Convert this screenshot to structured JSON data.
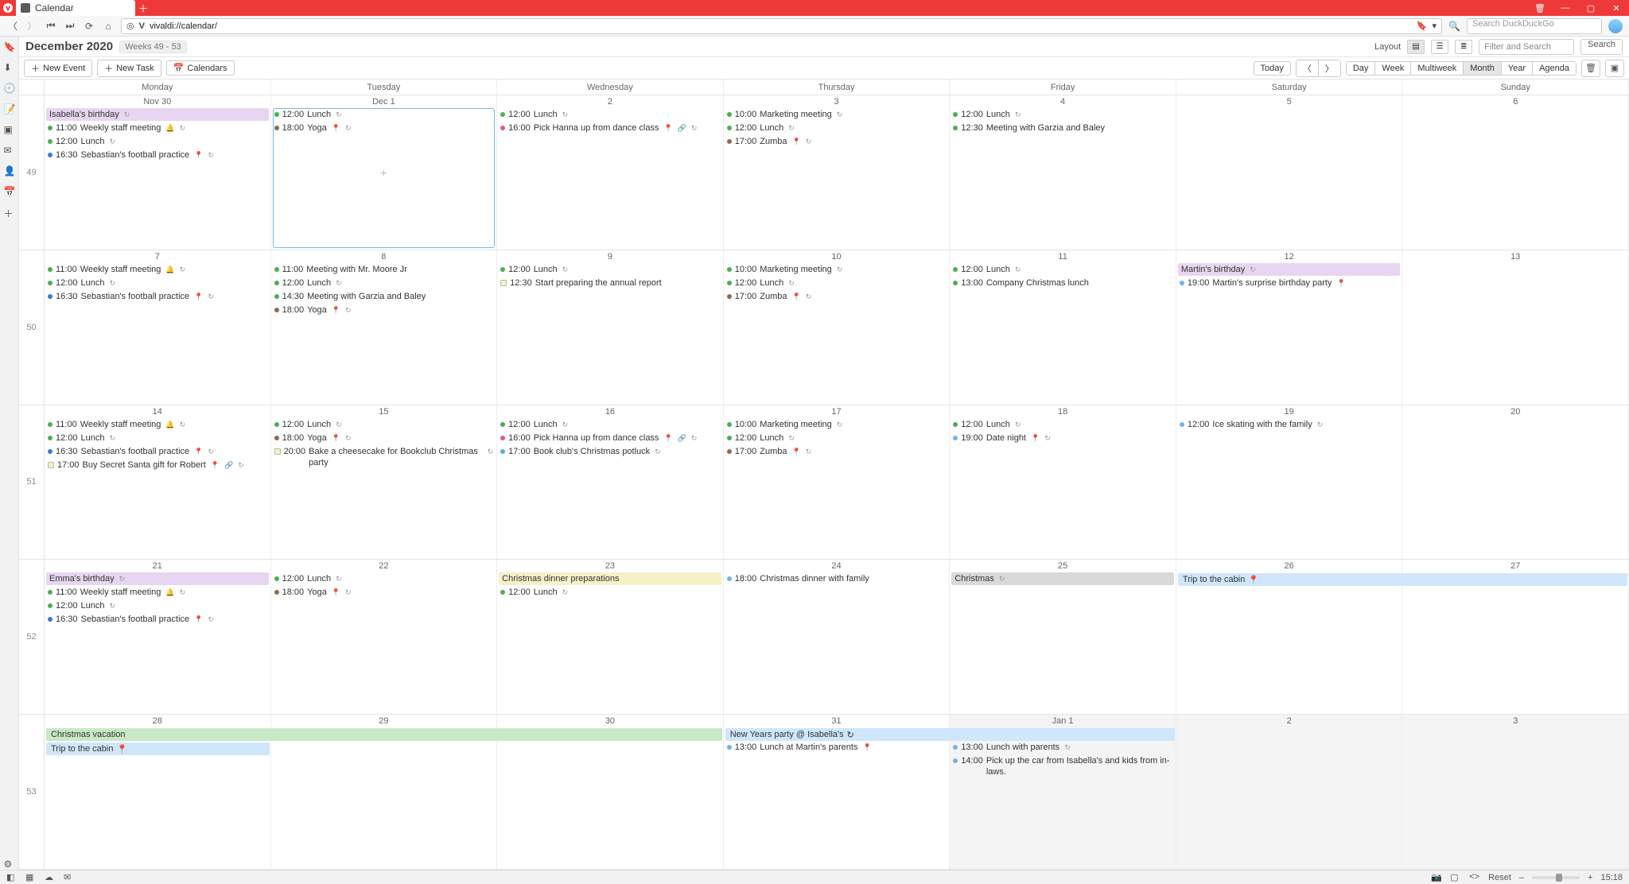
{
  "window": {
    "title": "Calendar"
  },
  "address": {
    "url_display": "vivaldi://calendar/",
    "search_placeholder": "Search DuckDuckGo"
  },
  "header": {
    "month_label": "December 2020",
    "weeks_label": "Weeks 49 - 53",
    "layout_label": "Layout",
    "filter_placeholder": "Filter and Search",
    "search_btn": "Search"
  },
  "toolbar": {
    "new_event": "New Event",
    "new_task": "New Task",
    "calendars": "Calendars",
    "today": "Today",
    "views": [
      "Day",
      "Week",
      "Multiweek",
      "Month",
      "Year",
      "Agenda"
    ],
    "view_selected": 3
  },
  "status": {
    "reset": "Reset",
    "clock": "15:18"
  },
  "days": [
    "Monday",
    "Tuesday",
    "Wednesday",
    "Thursday",
    "Friday",
    "Saturday",
    "Sunday"
  ],
  "week_numbers": [
    49,
    50,
    51,
    52,
    53
  ],
  "grid": [
    [
      {
        "d": "Nov 30",
        "events": [
          {
            "type": "allday",
            "color": "#e8d5f2",
            "text": "Isabella's birthday",
            "ics": [
              "↻"
            ]
          },
          {
            "dot": "c-green",
            "time": "11:00",
            "text": "Weekly staff meeting",
            "ics": [
              "🔔",
              "↻"
            ]
          },
          {
            "dot": "c-green",
            "time": "12:00",
            "text": "Lunch",
            "ics": [
              "↻"
            ]
          },
          {
            "dot": "c-blue",
            "time": "16:30",
            "text": "Sebastian's football practice",
            "ics": [
              "📍",
              "↻"
            ]
          }
        ]
      },
      {
        "d": "Dec  1",
        "selected": true,
        "events": [
          {
            "dot": "c-green",
            "time": "12:00",
            "text": "Lunch",
            "ics": [
              "↻"
            ]
          },
          {
            "dot": "c-brown",
            "time": "18:00",
            "text": "Yoga",
            "ics": [
              "📍",
              "↻"
            ]
          }
        ]
      },
      {
        "d": "2",
        "events": [
          {
            "dot": "c-green",
            "time": "12:00",
            "text": "Lunch",
            "ics": [
              "↻"
            ]
          },
          {
            "dot": "c-pink",
            "time": "16:00",
            "text": "Pick Hanna up from dance class",
            "ics": [
              "📍",
              "🔗",
              "↻"
            ]
          }
        ]
      },
      {
        "d": "3",
        "events": [
          {
            "dot": "c-green",
            "time": "10:00",
            "text": "Marketing meeting",
            "ics": [
              "↻"
            ]
          },
          {
            "dot": "c-green",
            "time": "12:00",
            "text": "Lunch",
            "ics": [
              "↻"
            ]
          },
          {
            "dot": "c-brown",
            "time": "17:00",
            "text": "Zumba",
            "ics": [
              "📍",
              "↻"
            ]
          }
        ]
      },
      {
        "d": "4",
        "events": [
          {
            "dot": "c-green",
            "time": "12:00",
            "text": "Lunch",
            "ics": [
              "↻"
            ]
          },
          {
            "dot": "c-green",
            "time": "12:30",
            "text": "Meeting with Garzia and Baley"
          }
        ]
      },
      {
        "d": "5",
        "events": []
      },
      {
        "d": "6",
        "events": []
      }
    ],
    [
      {
        "d": "7",
        "events": [
          {
            "dot": "c-green",
            "time": "11:00",
            "text": "Weekly staff meeting",
            "ics": [
              "🔔",
              "↻"
            ]
          },
          {
            "dot": "c-green",
            "time": "12:00",
            "text": "Lunch",
            "ics": [
              "↻"
            ]
          },
          {
            "dot": "c-blue",
            "time": "16:30",
            "text": "Sebastian's football practice",
            "ics": [
              "📍",
              "↻"
            ]
          }
        ]
      },
      {
        "d": "8",
        "events": [
          {
            "dot": "c-green",
            "time": "11:00",
            "text": "Meeting with Mr. Moore Jr"
          },
          {
            "dot": "c-green",
            "time": "12:00",
            "text": "Lunch",
            "ics": [
              "↻"
            ]
          },
          {
            "dot": "c-green",
            "time": "14:30",
            "text": "Meeting with Garzia and Baley"
          },
          {
            "dot": "c-brown",
            "time": "18:00",
            "text": "Yoga",
            "ics": [
              "📍",
              "↻"
            ]
          }
        ]
      },
      {
        "d": "9",
        "events": [
          {
            "dot": "c-green",
            "time": "12:00",
            "text": "Lunch",
            "ics": [
              "↻"
            ]
          },
          {
            "sq": true,
            "time": "12:30",
            "text": "Start preparing the annual report"
          }
        ]
      },
      {
        "d": "10",
        "events": [
          {
            "dot": "c-green",
            "time": "10:00",
            "text": "Marketing meeting",
            "ics": [
              "↻"
            ]
          },
          {
            "dot": "c-green",
            "time": "12:00",
            "text": "Lunch",
            "ics": [
              "↻"
            ]
          },
          {
            "dot": "c-brown",
            "time": "17:00",
            "text": "Zumba",
            "ics": [
              "📍",
              "↻"
            ]
          }
        ]
      },
      {
        "d": "11",
        "events": [
          {
            "dot": "c-green",
            "time": "12:00",
            "text": "Lunch",
            "ics": [
              "↻"
            ]
          },
          {
            "dot": "c-green",
            "time": "13:00",
            "text": "Company Christmas lunch"
          }
        ]
      },
      {
        "d": "12",
        "events": [
          {
            "type": "allday",
            "color": "#e8d5f2",
            "text": "Martin's birthday",
            "ics": [
              "↻"
            ]
          },
          {
            "dot": "c-lblue",
            "time": "19:00",
            "text": "Martin's surprise birthday party",
            "ics": [
              "📍"
            ]
          }
        ]
      },
      {
        "d": "13",
        "events": []
      }
    ],
    [
      {
        "d": "14",
        "events": [
          {
            "dot": "c-green",
            "time": "11:00",
            "text": "Weekly staff meeting",
            "ics": [
              "🔔",
              "↻"
            ]
          },
          {
            "dot": "c-green",
            "time": "12:00",
            "text": "Lunch",
            "ics": [
              "↻"
            ]
          },
          {
            "dot": "c-blue",
            "time": "16:30",
            "text": "Sebastian's football practice",
            "ics": [
              "📍",
              "↻"
            ]
          },
          {
            "sq": true,
            "time": "17:00",
            "text": "Buy Secret Santa gift for Robert",
            "ics": [
              "📍",
              "🔗",
              "↻"
            ]
          }
        ]
      },
      {
        "d": "15",
        "events": [
          {
            "dot": "c-green",
            "time": "12:00",
            "text": "Lunch",
            "ics": [
              "↻"
            ]
          },
          {
            "dot": "c-brown",
            "time": "18:00",
            "text": "Yoga",
            "ics": [
              "📍",
              "↻"
            ]
          },
          {
            "sq": true,
            "time": "20:00",
            "text": "Bake a cheesecake for Bookclub Christmas party",
            "ics": [
              "↻"
            ]
          }
        ]
      },
      {
        "d": "16",
        "events": [
          {
            "dot": "c-green",
            "time": "12:00",
            "text": "Lunch",
            "ics": [
              "↻"
            ]
          },
          {
            "dot": "c-pink",
            "time": "16:00",
            "text": "Pick Hanna up from dance class",
            "ics": [
              "📍",
              "🔗",
              "↻"
            ]
          },
          {
            "dot": "c-cyan",
            "time": "17:00",
            "text": "Book club's Christmas potluck",
            "ics": [
              "↻"
            ]
          }
        ]
      },
      {
        "d": "17",
        "events": [
          {
            "dot": "c-green",
            "time": "10:00",
            "text": "Marketing meeting",
            "ics": [
              "↻"
            ]
          },
          {
            "dot": "c-green",
            "time": "12:00",
            "text": "Lunch",
            "ics": [
              "↻"
            ]
          },
          {
            "dot": "c-brown",
            "time": "17:00",
            "text": "Zumba",
            "ics": [
              "📍",
              "↻"
            ]
          }
        ]
      },
      {
        "d": "18",
        "events": [
          {
            "dot": "c-green",
            "time": "12:00",
            "text": "Lunch",
            "ics": [
              "↻"
            ]
          },
          {
            "dot": "c-lblue",
            "time": "19:00",
            "text": "Date night",
            "ics": [
              "📍",
              "↻"
            ]
          }
        ]
      },
      {
        "d": "19",
        "events": [
          {
            "dot": "c-lblue",
            "time": "12:00",
            "text": "Ice skating with the family",
            "ics": [
              "↻"
            ]
          }
        ]
      },
      {
        "d": "20",
        "events": []
      }
    ],
    [
      {
        "d": "21",
        "events": [
          {
            "type": "allday",
            "color": "#e8d5f2",
            "text": "Emma's birthday",
            "ics": [
              "↻"
            ]
          },
          {
            "dot": "c-green",
            "time": "11:00",
            "text": "Weekly staff meeting",
            "ics": [
              "🔔",
              "↻"
            ]
          },
          {
            "dot": "c-green",
            "time": "12:00",
            "text": "Lunch",
            "ics": [
              "↻"
            ]
          },
          {
            "dot": "c-blue",
            "time": "16:30",
            "text": "Sebastian's football practice",
            "ics": [
              "📍",
              "↻"
            ]
          }
        ]
      },
      {
        "d": "22",
        "events": [
          {
            "dot": "c-green",
            "time": "12:00",
            "text": "Lunch",
            "ics": [
              "↻"
            ]
          },
          {
            "dot": "c-brown",
            "time": "18:00",
            "text": "Yoga",
            "ics": [
              "📍",
              "↻"
            ]
          }
        ]
      },
      {
        "d": "23",
        "events": [
          {
            "type": "allday",
            "color": "#f6f0c8",
            "text": "Christmas dinner preparations"
          },
          {
            "dot": "c-green",
            "time": "12:00",
            "text": "Lunch",
            "ics": [
              "↻"
            ]
          }
        ]
      },
      {
        "d": "24",
        "events": [
          {
            "dot": "c-lblue",
            "time": "18:00",
            "text": "Christmas dinner with family"
          }
        ]
      },
      {
        "d": "25",
        "events": [
          {
            "type": "allday",
            "color": "#d9d9d9",
            "text": "Christmas",
            "ics": [
              "↻"
            ]
          }
        ]
      },
      {
        "d": "26",
        "events": []
      },
      {
        "d": "27",
        "events": []
      }
    ],
    [
      {
        "d": "28",
        "events": []
      },
      {
        "d": "29",
        "events": []
      },
      {
        "d": "30",
        "events": []
      },
      {
        "d": "31",
        "events": [
          {
            "dot": "c-lblue",
            "time": "13:00",
            "text": "Lunch at Martin's parents",
            "ics": [
              "📍"
            ]
          }
        ]
      },
      {
        "d": "Jan  1",
        "out": true,
        "events": [
          {
            "dot": "c-lblue",
            "time": "13:00",
            "text": "Lunch with parents",
            "ics": [
              "↻"
            ]
          },
          {
            "dot": "c-lblue",
            "time": "14:00",
            "text": "Pick up the car from Isabella's and kids from in-laws."
          }
        ]
      },
      {
        "d": "2",
        "out": true,
        "events": []
      },
      {
        "d": "3",
        "out": true,
        "events": []
      }
    ]
  ],
  "multiday": [
    {
      "row": 3,
      "startCol": 5,
      "endCol": 7,
      "slot": 0,
      "color": "#cfe6fb",
      "text": "Trip to the cabin",
      "ics": [
        "📍"
      ]
    },
    {
      "row": 4,
      "startCol": 0,
      "endCol": 3,
      "slot": 0,
      "color": "#c9e8c5",
      "text": "Christmas vacation"
    },
    {
      "row": 4,
      "startCol": 3,
      "endCol": 5,
      "slot": 0,
      "color": "#cfe6fb",
      "text": "New Years party @ Isabella's",
      "ics": [
        "↻"
      ]
    },
    {
      "row": 4,
      "startCol": 0,
      "endCol": 1,
      "slot": 1,
      "color": "#cfe6fb",
      "text": "Trip to the cabin",
      "ics": [
        "📍"
      ]
    }
  ]
}
